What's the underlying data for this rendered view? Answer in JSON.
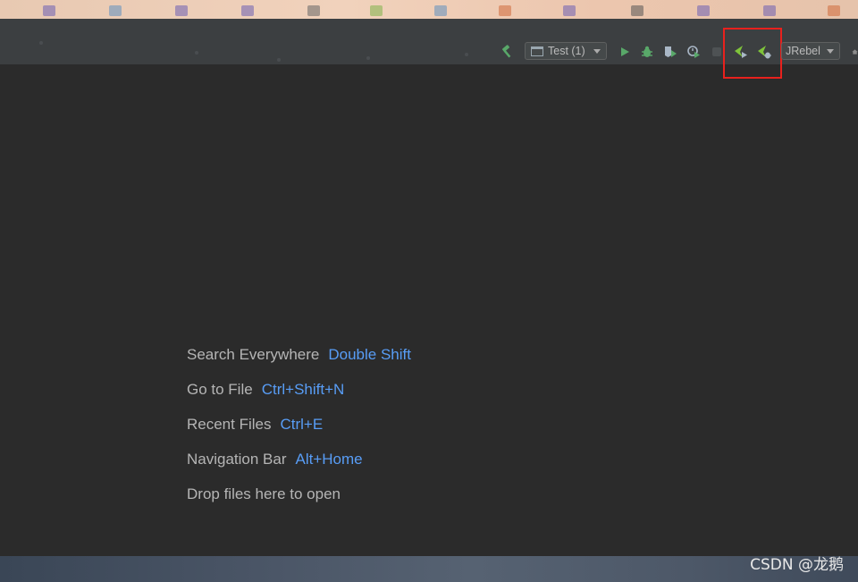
{
  "toolbar": {
    "run_config": {
      "label": "Test (1)",
      "icon": "run-config-icon"
    },
    "jrebel_select": {
      "label": "JRebel"
    },
    "icons": {
      "build": "hammer-icon",
      "run": "play-icon",
      "debug": "bug-icon",
      "coverage": "coverage-icon",
      "profile": "profile-icon",
      "stop": "stop-icon",
      "jrebel_run": "jrebel-run-icon",
      "jrebel_debug": "jrebel-debug-icon",
      "overflow": "house-icon"
    }
  },
  "welcome_hints": [
    {
      "label": "Search Everywhere",
      "key": "Double Shift"
    },
    {
      "label": "Go to File",
      "key": "Ctrl+Shift+N"
    },
    {
      "label": "Recent Files",
      "key": "Ctrl+E"
    },
    {
      "label": "Navigation Bar",
      "key": "Alt+Home"
    },
    {
      "label": "Drop files here to open",
      "key": ""
    }
  ],
  "watermark": "CSDN @龙鹅",
  "colors": {
    "editor_bg": "#2b2b2b",
    "toolbar_bg": "#3c3f41",
    "hint_text": "#b5b5b5",
    "shortcut_text": "#589df6",
    "green_icon": "#59a869",
    "highlight": "#e8211d"
  }
}
